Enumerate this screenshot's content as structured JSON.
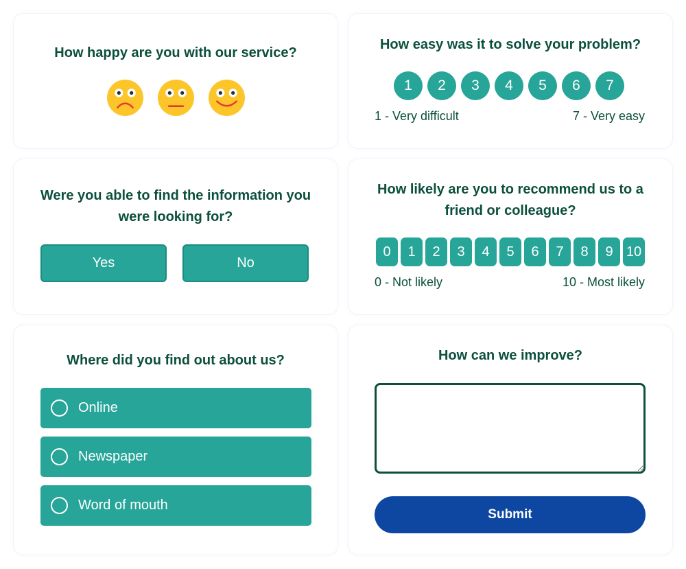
{
  "colors": {
    "heading": "#0b4f3c",
    "teal": "#26a598",
    "submit_blue": "#0d47a1",
    "emoji_yellow": "#fcc62b",
    "emoji_mouth": "#e53935"
  },
  "happiness": {
    "question": "How happy are you with our service?",
    "faces": [
      {
        "icon": "sad-face-icon",
        "mood": "unhappy"
      },
      {
        "icon": "neutral-face-icon",
        "mood": "neutral"
      },
      {
        "icon": "happy-face-icon",
        "mood": "happy"
      }
    ]
  },
  "ease": {
    "question": "How easy was it to solve your problem?",
    "options": [
      "1",
      "2",
      "3",
      "4",
      "5",
      "6",
      "7"
    ],
    "min_label": "1 - Very difficult",
    "max_label": "7 - Very easy"
  },
  "found_info": {
    "question_line1": "Were you able to find the information you",
    "question_line2": "were looking for?",
    "yes_label": "Yes",
    "no_label": "No"
  },
  "nps": {
    "question_line1": "How likely are you to recommend us to a",
    "question_line2": "friend or colleague?",
    "options": [
      "0",
      "1",
      "2",
      "3",
      "4",
      "5",
      "6",
      "7",
      "8",
      "9",
      "10"
    ],
    "min_label": "0 - Not likely",
    "max_label": "10 - Most likely"
  },
  "source": {
    "question": "Where did you find out about us?",
    "options": [
      "Online",
      "Newspaper",
      "Word of mouth"
    ]
  },
  "improve": {
    "question": "How can we improve?",
    "textarea_value": "",
    "submit_label": "Submit"
  }
}
